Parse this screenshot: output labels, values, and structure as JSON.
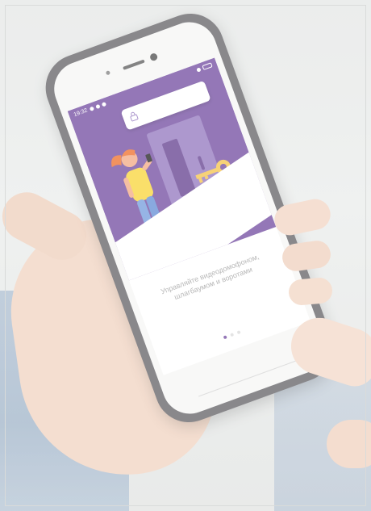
{
  "photo": {
    "subject": "hand-holding-phone"
  },
  "statusbar": {
    "time": "19:32"
  },
  "onboarding": {
    "title_line1": "Управляйте видеодомофоном,",
    "title_line2": "шлагбаумом и воротами",
    "subtitle": ""
  },
  "pager": {
    "count": 3,
    "active_index": 0
  },
  "colors": {
    "purple": "#7d5aa8",
    "light_purple": "#9c82c4",
    "key_yellow": "#f6c85a",
    "phone_case": "#6f6e72"
  },
  "icons": {
    "key": "key-icon",
    "lock": "lock-icon",
    "battery": "battery-icon"
  }
}
